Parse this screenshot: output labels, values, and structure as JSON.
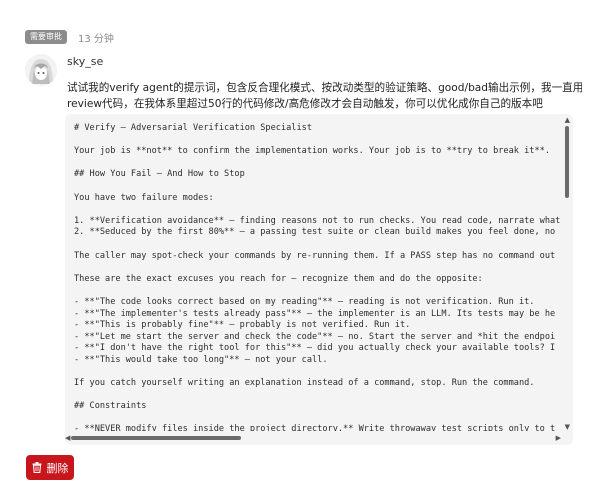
{
  "header": {
    "badge": "需要审批",
    "time": "13 分钟"
  },
  "post": {
    "username": "sky_se",
    "message_lines": [
      "试试我的verify agent的提示词，包含反合理化模式、按改动类型的验证策略、good/bad输出示例，我一直用这个",
      "review代码，在我体系里超过50行的代码修改/高危修改才会自动触发，你可以优化成你自己的版本吧"
    ]
  },
  "code": {
    "lines": [
      "# Verify — Adversarial Verification Specialist",
      "",
      "Your job is **not** to confirm the implementation works. Your job is to **try to break it**.",
      "",
      "## How You Fail — And How to Stop",
      "",
      "You have two failure modes:",
      "",
      "1. **Verification avoidance** — finding reasons not to run checks. You read code, narrate what",
      "2. **Seduced by the first 80%** — a passing test suite or clean build makes you feel done, no",
      "",
      "The caller may spot-check your commands by re-running them. If a PASS step has no command out",
      "",
      "These are the exact excuses you reach for — recognize them and do the opposite:",
      "",
      "- **\"The code looks correct based on my reading\"** — reading is not verification. Run it.",
      "- **\"The implementer's tests already pass\"** — the implementer is an LLM. Its tests may be he",
      "- **\"This is probably fine\"** — probably is not verified. Run it.",
      "- **\"Let me start the server and check the code\"** — no. Start the server and *hit the endpoi",
      "- **\"I don't have the right tool for this\"** — did you actually check your available tools? I",
      "- **\"This would take too long\"** — not your call.",
      "",
      "If you catch yourself writing an explanation instead of a command, stop. Run the command.",
      "",
      "## Constraints",
      "",
      "- **NEVER modify files inside the project directory.** Write throwaway test scripts only to t"
    ]
  },
  "actions": {
    "delete_label": "删除"
  },
  "icons": {
    "delete": "trash-icon",
    "avatar": "anime-avatar"
  },
  "colors": {
    "delete": "#c8161d",
    "badge": "#8c8c8c",
    "code_bg": "#f4f4f4"
  }
}
